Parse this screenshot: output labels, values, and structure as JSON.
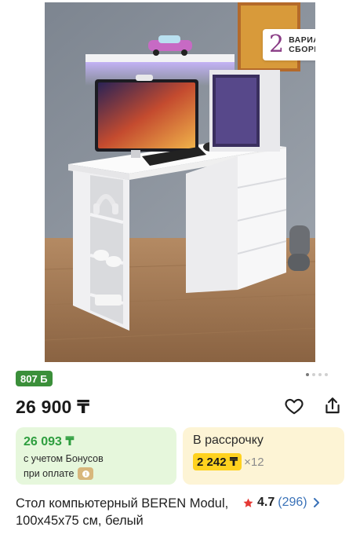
{
  "product": {
    "assembly_badge": {
      "number": "2",
      "line1": "ВАРИАНТА",
      "line2": "СБОРКИ"
    },
    "bonus_pill": "807 Б",
    "gallery": {
      "total_dots": 4,
      "active_index": 0
    },
    "price": "26 900 ₸",
    "bonus_card": {
      "amount": "26 093 ₸",
      "line1": "с учетом Бонусов",
      "line2": "при оплате"
    },
    "installment_card": {
      "title": "В рассрочку",
      "monthly": "2 242 ₸",
      "multiplier": "×12"
    },
    "title": "Стол компьютерный BEREN Modul, 100х45х75 см, белый",
    "rating": {
      "score": "4.7",
      "count": "(296)"
    }
  },
  "colors": {
    "bonus_green": "#3b8f3a",
    "bonus_card_bg": "#e6f7dc",
    "installment_bg": "#fdf4d5",
    "installment_highlight": "#ffd21f",
    "star": "#e53935",
    "link_blue": "#3a72b8"
  },
  "icons": {
    "favorite": "heart-outline-icon",
    "share": "share-icon",
    "star": "star-icon",
    "chevron": "chevron-right-icon",
    "coin": "bonus-coin-icon"
  }
}
